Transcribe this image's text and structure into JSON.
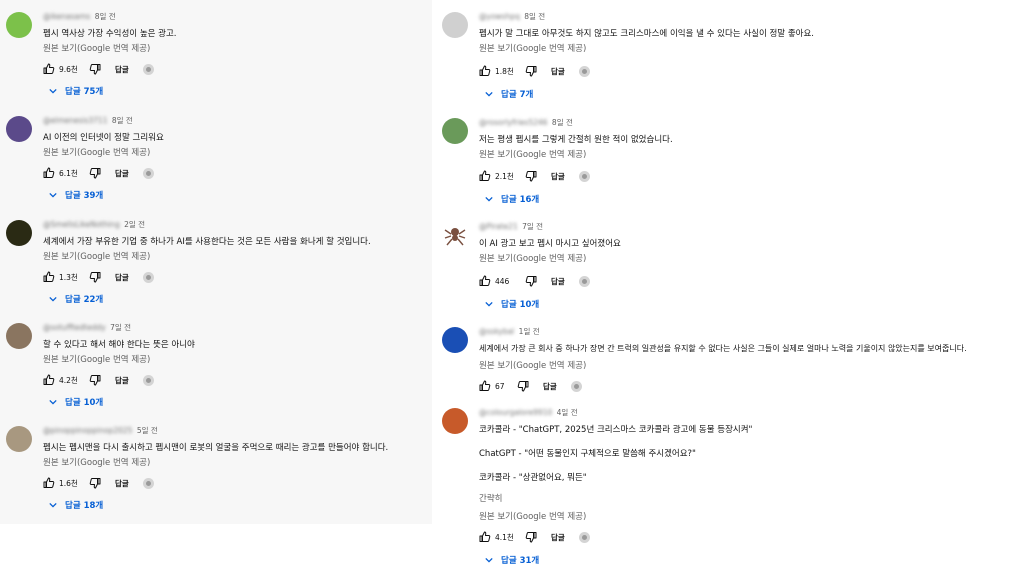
{
  "left_comments": [
    {
      "handle": "@ikenasams",
      "time": "8일 전",
      "lines": [
        "펩시 역사상 가장 수익성이 높은 광고."
      ],
      "translate": "원본 보기(Google 번역 제공)",
      "likes": "9.6천",
      "reply": "답글",
      "replies": "답글 75개",
      "avatar_color": "#7cc14a"
    },
    {
      "handle": "@elmenesis3711",
      "time": "8일 전",
      "lines": [
        "AI 이전의 인터넷이 정말 그리워요"
      ],
      "translate": "원본 보기(Google 번역 제공)",
      "likes": "6.1천",
      "reply": "답글",
      "replies": "답글 39개",
      "avatar_color": "#5b4a8a"
    },
    {
      "handle": "@SmellsLikeNothing",
      "time": "2일 전",
      "lines": [
        "세계에서 가장 부유한 기업 중 하나가 AI를 사용한다는 것은 모든 사람을 화나게 할 것입니다."
      ],
      "translate": "원본 보기(Google 번역 제공)",
      "likes": "1.3천",
      "reply": "답글",
      "replies": "답글 22개",
      "avatar_color": "#2a2a14"
    },
    {
      "handle": "@sotufftedteddy",
      "time": "7일 전",
      "lines": [
        "할 수 있다고 해서 해야 한다는 뜻은 아니야"
      ],
      "translate": "원본 보기(Google 번역 제공)",
      "likes": "4.2천",
      "reply": "답글",
      "replies": "답글 10개",
      "avatar_color": "#8a7560"
    },
    {
      "handle": "@pinoppinoppinop2025",
      "time": "5일 전",
      "lines": [
        "펩시는 펩시맨을 다시 출시하고 펩시맨이 로봇의 얼굴을 주먹으로 때리는 광고를 만들어야 합니다."
      ],
      "translate": "원본 보기(Google 번역 제공)",
      "likes": "1.6천",
      "reply": "답글",
      "replies": "답글 18개",
      "avatar_color": "#a89880"
    }
  ],
  "right_comments": [
    {
      "handle": "@yowshpq",
      "time": "8일 전",
      "lines": [
        "펩시가 말 그대로 아무것도 하지 않고도 크리스마스에 이익을 낼 수 있다는 사실이 정말 좋아요."
      ],
      "translate": "원본 보기(Google 번역 제공)",
      "likes": "1.8천",
      "reply": "답글",
      "replies": "답글 7개",
      "avatar_color": "#d0d0d0"
    },
    {
      "handle": "@rosorlyfries5246",
      "time": "8일 전",
      "lines": [
        "저는 평생 펩시를 그렇게 간절히 원한 적이 없었습니다."
      ],
      "translate": "원본 보기(Google 번역 제공)",
      "likes": "2.1천",
      "reply": "답글",
      "replies": "답글 16개",
      "avatar_color": "#6a9a5a"
    },
    {
      "handle": "@Pirate21",
      "time": "7일 전",
      "lines": [
        "이 AI 광고 보고 펩시 마시고 싶어졌어요"
      ],
      "translate": "원본 보기(Google 번역 제공)",
      "likes": "446",
      "reply": "답글",
      "replies": "답글 10개",
      "avatar_color": "#7a5040"
    },
    {
      "handle": "@sskybal",
      "time": "1일 전",
      "lines": [
        "세계에서 가장 큰 회사 중 하나가 장면 간 트럭의 일관성을 유지할 수 없다는 사실은 그들이 실제로 얼마나 노력을 기울이지 않았는지를 보여줍니다."
      ],
      "translate": "원본 보기(Google 번역 제공)",
      "likes": "67",
      "reply": "답글",
      "replies": "",
      "avatar_color": "#1a4fb5"
    },
    {
      "handle": "@colourgalore9910",
      "time": "4일 전",
      "lines": [
        "코카콜라 - \"ChatGPT, 2025년 크리스마스 코카콜라 광고에 동물 등장시켜\"",
        "",
        "ChatGPT - \"어떤 동물인지 구체적으로 말씀해 주시겠어요?\"",
        "",
        "코카콜라 - \"상관없어요, 뭐든\""
      ],
      "subtext": "간략히",
      "translate": "원본 보기(Google 번역 제공)",
      "likes": "4.1천",
      "reply": "답글",
      "replies": "답글 31개",
      "avatar_color": "#c75a2a"
    }
  ]
}
